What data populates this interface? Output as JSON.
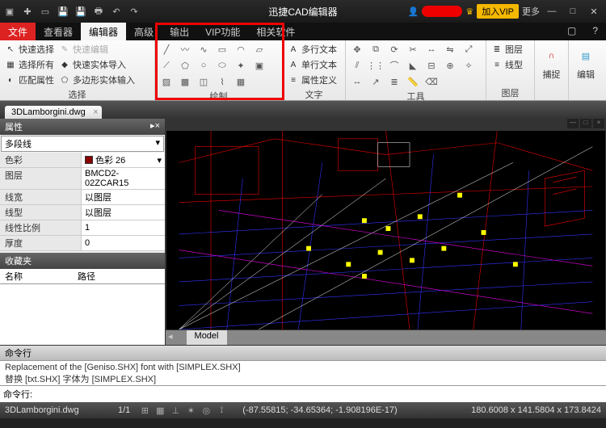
{
  "titlebar": {
    "app_title": "迅捷CAD编辑器",
    "vip_label": "加入VIP",
    "more_label": "更多"
  },
  "tabs": {
    "file": "文件",
    "viewer": "查看器",
    "editor": "编辑器",
    "advanced": "高级",
    "output": "输出",
    "vip": "VIP功能",
    "related": "相关软件"
  },
  "ribbon": {
    "select": {
      "label": "选择",
      "quick_select": "快速选择",
      "select_all": "选择所有",
      "match_attrs": "匹配属性",
      "quick_edit": "快速编辑",
      "quick_solid_import": "快速实体导入",
      "polygon_solid_input": "多边形实体输入"
    },
    "draw": {
      "label": "绘制"
    },
    "text": {
      "label": "文字",
      "mtext": "多行文本",
      "stext": "单行文本",
      "attrdef": "属性定义"
    },
    "tools": {
      "label": "工具"
    },
    "layers": {
      "label": "图层",
      "layer_btn": "图层",
      "linetype_btn": "线型"
    },
    "snap": "捕捉",
    "edit_big": "编辑"
  },
  "doc_tab": "3DLamborgini.dwg",
  "properties": {
    "title": "属性",
    "selection": "多段线",
    "rows": {
      "color_k": "色彩",
      "color_v": "色彩 26",
      "layer_k": "图层",
      "layer_v": "BMCD2-02ZCAR15",
      "lw_k": "线宽",
      "lw_v": "以图层",
      "lt_k": "线型",
      "lt_v": "以图层",
      "ls_k": "线性比例",
      "ls_v": "1",
      "thick_k": "厚度",
      "thick_v": "0"
    }
  },
  "favorites": {
    "title": "收藏夹",
    "col_name": "名称",
    "col_path": "路径"
  },
  "model_tab": "Model",
  "command": {
    "title": "命令行",
    "log1": "Replacement of the [Geniso.SHX] font with [SIMPLEX.SHX]",
    "log2": "替换 [txt.SHX] 字体为 [SIMPLEX.SHX]",
    "prompt": "命令行:"
  },
  "status": {
    "file": "3DLamborgini.dwg",
    "ratio": "1/1",
    "coords": "(-87.55815; -34.65364; -1.908196E-17)",
    "size": "180.6008 x 141.5804 x 173.8424"
  }
}
